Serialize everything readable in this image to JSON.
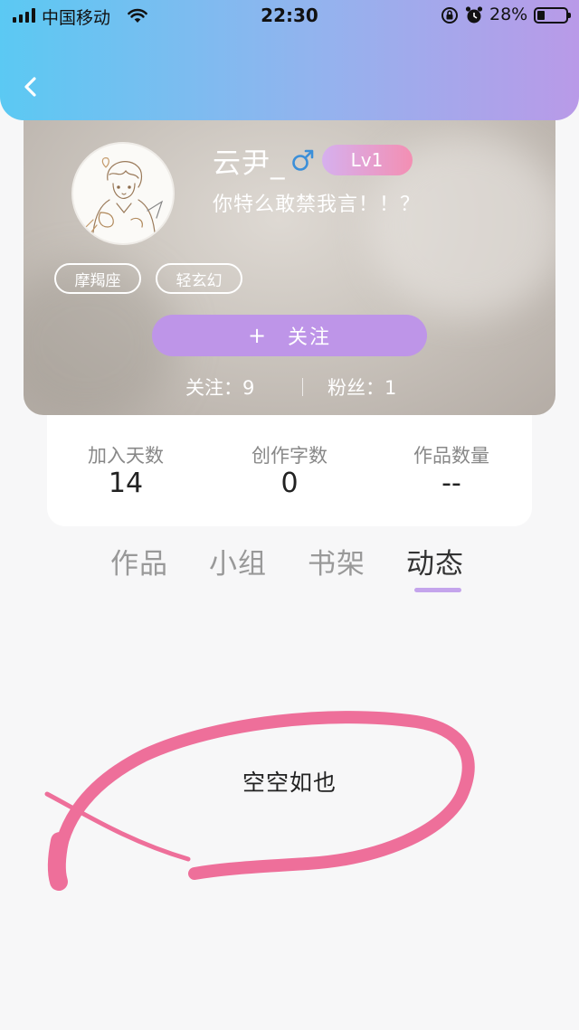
{
  "status_bar": {
    "carrier": "中国移动",
    "time": "22:30",
    "battery_percent": "28%",
    "battery_level": 0.28,
    "icons": [
      "signal-icon",
      "wifi-icon",
      "orientation-lock-icon",
      "alarm-icon",
      "battery-icon"
    ]
  },
  "header": {
    "back_icon": "chevron-left-icon",
    "gradient": [
      "#5bc9f3",
      "#b99ae8"
    ]
  },
  "profile": {
    "username": "云尹_",
    "gender_icon": "male-icon",
    "gender_color": "#3b8fd9",
    "level": "Lv1",
    "bio": "你特么敢禁我言！！？",
    "tags": [
      "摩羯座",
      "轻玄幻"
    ],
    "follow_button": "＋  关注",
    "follow_plus": "+",
    "follow_label": "关注",
    "following": "关注：9",
    "fans": "粉丝：1"
  },
  "stats": [
    {
      "label": "加入天数",
      "value": "14"
    },
    {
      "label": "创作字数",
      "value": "0"
    },
    {
      "label": "作品数量",
      "value": "--"
    }
  ],
  "tabs": [
    {
      "label": "作品",
      "active": false
    },
    {
      "label": "小组",
      "active": false
    },
    {
      "label": "书架",
      "active": false
    },
    {
      "label": "动态",
      "active": true
    }
  ],
  "empty_state": {
    "text": "空空如也",
    "annotation_color": "#ee6f9a"
  },
  "colors": {
    "accent": "#be95e8",
    "tab_underline": "#c4a4ec",
    "level_badge": [
      "#d6b0ee",
      "#f38fb3"
    ]
  }
}
